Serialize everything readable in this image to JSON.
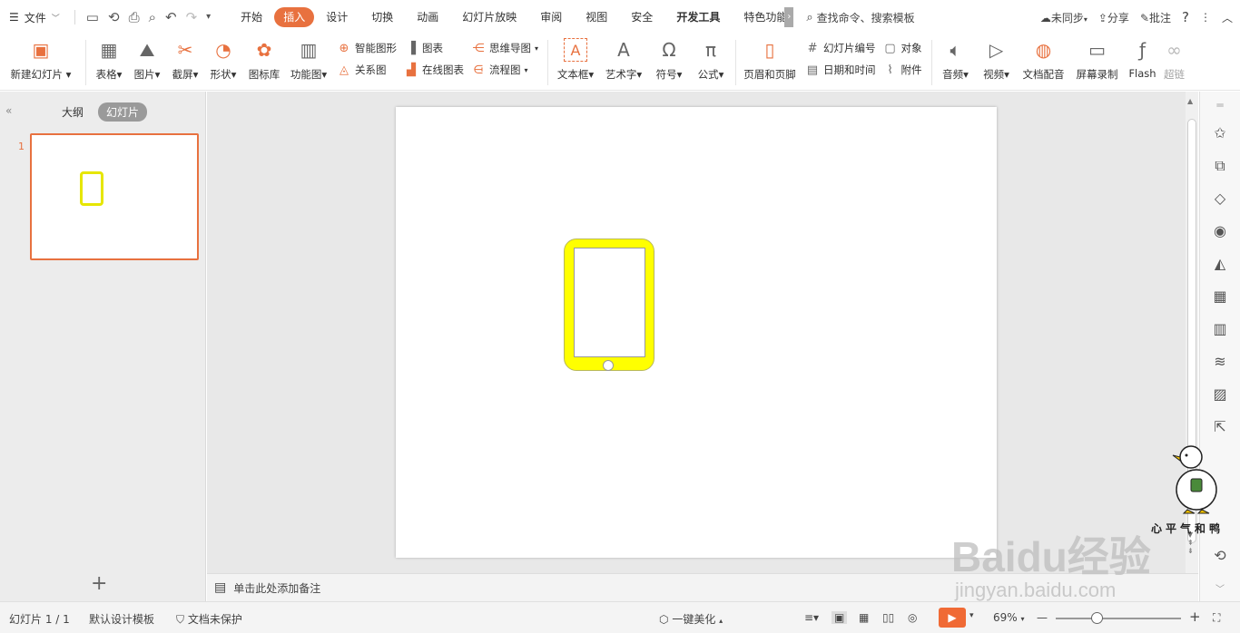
{
  "menubar": {
    "file_label": "文件",
    "tabs": [
      {
        "label": "开始"
      },
      {
        "label": "插入",
        "active": true
      },
      {
        "label": "设计"
      },
      {
        "label": "切换"
      },
      {
        "label": "动画"
      },
      {
        "label": "幻灯片放映"
      },
      {
        "label": "审阅"
      },
      {
        "label": "视图"
      },
      {
        "label": "安全"
      },
      {
        "label": "开发工具"
      },
      {
        "label": "特色功能"
      }
    ],
    "search_label": "查找命令、搜索模板",
    "sync_label": "未同步",
    "share_label": "分享",
    "comment_label": "批注",
    "help_label": "?"
  },
  "ribbon": {
    "new_slide": "新建幻灯片",
    "table": "表格",
    "picture": "图片",
    "screenshot": "截屏",
    "shape": "形状",
    "icon_lib": "图标库",
    "func_chart": "功能图",
    "smart_shape": "智能图形",
    "chart": "图表",
    "relation": "关系图",
    "online_chart": "在线图表",
    "mindmap": "思维导图",
    "flowchart": "流程图",
    "textbox": "文本框",
    "wordart": "艺术字",
    "symbol": "符号",
    "formula": "公式",
    "header_footer": "页眉和页脚",
    "slide_number": "幻灯片编号",
    "object": "对象",
    "datetime": "日期和时间",
    "attachment": "附件",
    "audio": "音频",
    "video": "视频",
    "doc_dub": "文档配音",
    "screen_record": "屏幕录制",
    "flash": "Flash",
    "hyperlink": "超链"
  },
  "leftpanel": {
    "outline_tab": "大纲",
    "slides_tab": "幻灯片",
    "slide_number": "1"
  },
  "notes": {
    "placeholder": "单击此处添加备注"
  },
  "statusbar": {
    "slide_indicator": "幻灯片 1 / 1",
    "template": "默认设计模板",
    "protection": "文档未保护",
    "beautify": "一键美化",
    "zoom": "69%"
  },
  "watermark": {
    "caption": "心平气和鸭",
    "brand": "Baidu经验",
    "url": "jingyan.baidu.com"
  },
  "colors": {
    "accent": "#e8713f",
    "tablet_fill": "#ffff00",
    "play": "#f06a35"
  }
}
